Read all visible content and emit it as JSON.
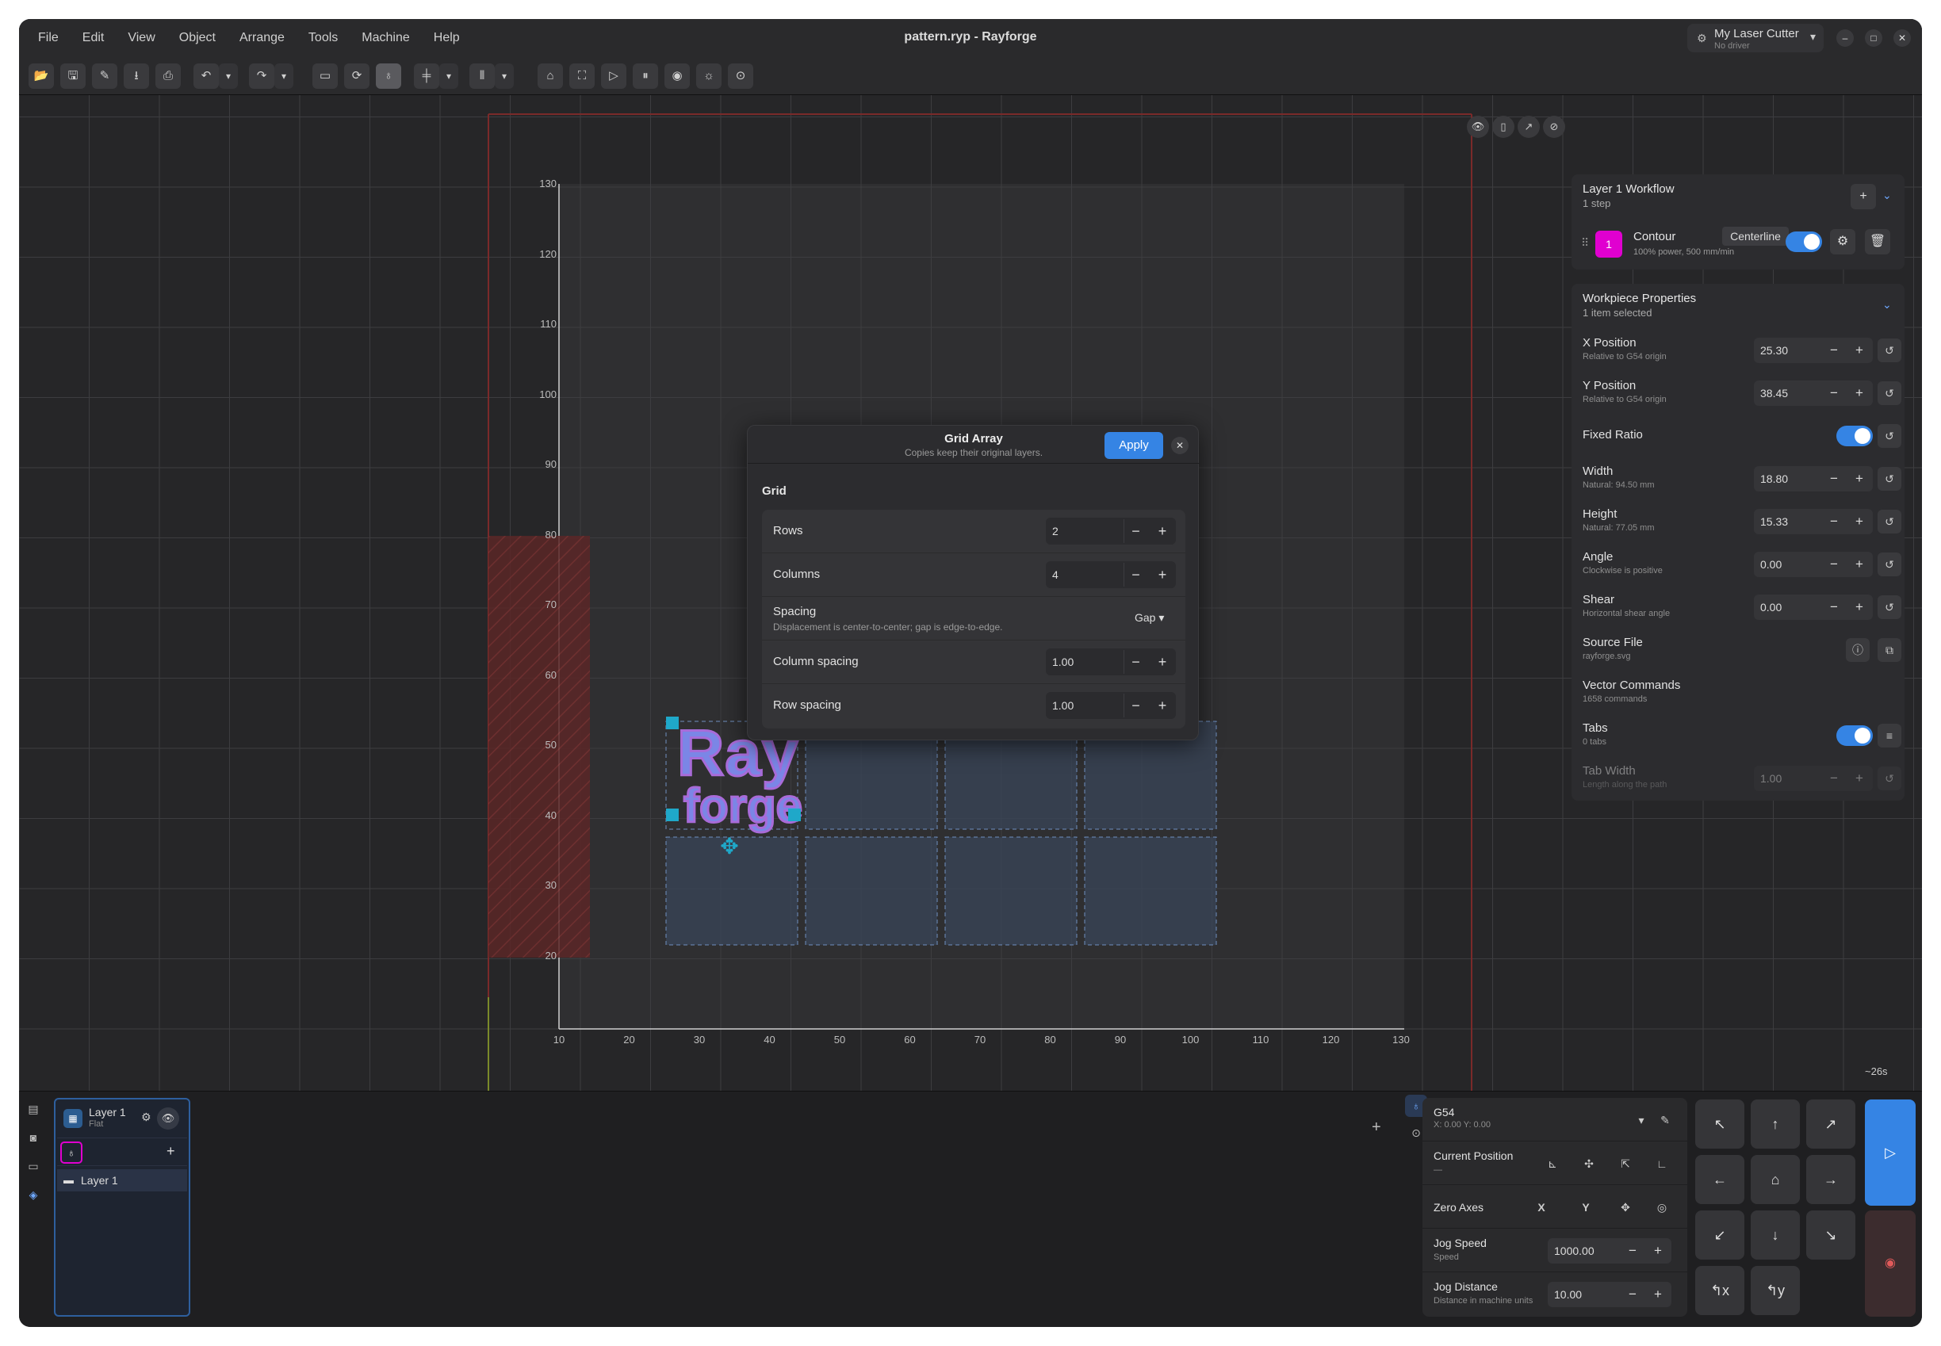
{
  "app": {
    "title": "pattern.ryp - Rayforge",
    "menu": [
      "File",
      "Edit",
      "View",
      "Object",
      "Arrange",
      "Tools",
      "Machine",
      "Help"
    ],
    "machine": {
      "name": "My Laser Cutter",
      "driver": "No driver"
    }
  },
  "toolbar": {
    "icons": [
      "open-icon",
      "save-icon",
      "save-as-icon",
      "import-icon",
      "export-icon",
      "undo-icon",
      "undo-dropdown-icon",
      "redo-icon",
      "redo-dropdown-icon",
      "frame-icon",
      "reload-icon",
      "tool-icon",
      "align-icon",
      "align-dropdown-icon",
      "distribute-icon",
      "distribute-dropdown-icon",
      "home-icon",
      "frame-outline-icon",
      "send-icon",
      "pause-icon",
      "record-icon",
      "laser-icon",
      "focus-icon"
    ]
  },
  "canvas": {
    "y_ticks": [
      "130",
      "120",
      "110",
      "100",
      "90",
      "80",
      "70",
      "60",
      "50",
      "40",
      "30",
      "20"
    ],
    "x_ticks": [
      "10",
      "20",
      "30",
      "40",
      "50",
      "60",
      "70",
      "80",
      "90",
      "100",
      "110",
      "120",
      "130"
    ],
    "logo_line1": "Ray",
    "logo_line2": "forge",
    "timer": "~26s"
  },
  "dialog": {
    "title": "Grid Array",
    "subtitle": "Copies keep their original layers.",
    "apply": "Apply",
    "section": "Grid",
    "rows_label": "Rows",
    "rows_value": "2",
    "columns_label": "Columns",
    "columns_value": "4",
    "spacing_label": "Spacing",
    "spacing_sub": "Displacement is center-to-center; gap is edge-to-edge.",
    "spacing_mode": "Gap",
    "column_spacing_label": "Column spacing",
    "column_spacing_value": "1.00",
    "row_spacing_label": "Row spacing",
    "row_spacing_value": "1.00"
  },
  "workflow": {
    "title": "Layer 1 Workflow",
    "sub": "1 step",
    "step_number": "1",
    "step_name": "Contour",
    "step_tag": "Centerline",
    "step_sub": "100% power, 500 mm/min"
  },
  "props": {
    "title": "Workpiece Properties",
    "sub": "1 item selected",
    "x_label": "X Position",
    "x_sub": "Relative to G54 origin",
    "x_value": "25.30",
    "y_label": "Y Position",
    "y_sub": "Relative to G54 origin",
    "y_value": "38.45",
    "ratio_label": "Fixed Ratio",
    "width_label": "Width",
    "width_sub": "Natural: 94.50 mm",
    "width_value": "18.80",
    "height_label": "Height",
    "height_sub": "Natural: 77.05 mm",
    "height_value": "15.33",
    "angle_label": "Angle",
    "angle_sub": "Clockwise is positive",
    "angle_value": "0.00",
    "shear_label": "Shear",
    "shear_sub": "Horizontal shear angle",
    "shear_value": "0.00",
    "source_label": "Source File",
    "source_sub": "rayforge.svg",
    "vector_label": "Vector Commands",
    "vector_sub": "1658 commands",
    "tabs_label": "Tabs",
    "tabs_sub": "0 tabs",
    "tabw_label": "Tab Width",
    "tabw_sub": "Length along the path",
    "tabw_value": "1.00"
  },
  "layers": {
    "name": "Layer 1",
    "sub": "Flat",
    "item": "Layer 1"
  },
  "control": {
    "wcs": "G54",
    "coords": "X: 0.00   Y: 0.00",
    "current_position": "Current Position",
    "current_sub": "—",
    "zero_axes": "Zero Axes",
    "zero_x": "X",
    "zero_y": "Y",
    "jog_speed_label": "Jog Speed",
    "jog_speed_sub": "Speed",
    "jog_speed_value": "1000.00",
    "jog_distance_label": "Jog Distance",
    "jog_distance_sub": "Distance in machine units",
    "jog_distance_value": "10.00"
  }
}
